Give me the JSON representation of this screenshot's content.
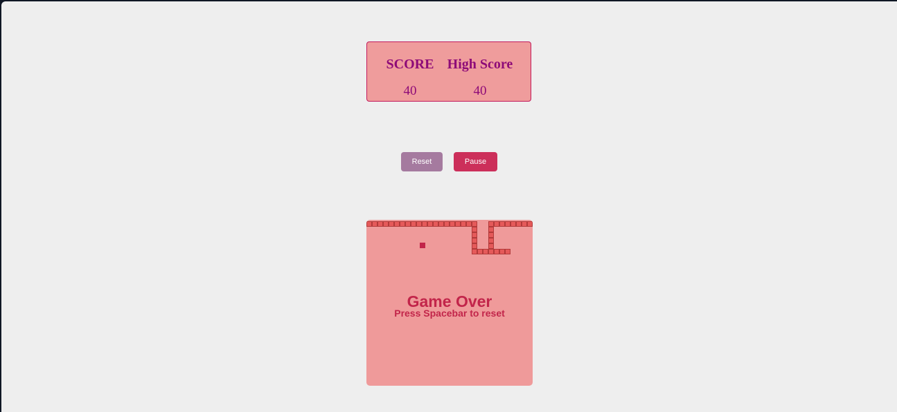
{
  "scoreboard": {
    "score_label": "SCORE",
    "score_value": "40",
    "high_score_label": "High Score",
    "high_score_value": "40"
  },
  "controls": {
    "reset_label": "Reset",
    "pause_label": "Pause"
  },
  "game": {
    "status_title": "Game Over",
    "status_hint": "Press Spacebar to reset",
    "grid_size": 30,
    "snake_cells": [
      [
        0,
        0
      ],
      [
        1,
        0
      ],
      [
        2,
        0
      ],
      [
        3,
        0
      ],
      [
        4,
        0
      ],
      [
        5,
        0
      ],
      [
        6,
        0
      ],
      [
        7,
        0
      ],
      [
        8,
        0
      ],
      [
        9,
        0
      ],
      [
        10,
        0
      ],
      [
        11,
        0
      ],
      [
        12,
        0
      ],
      [
        13,
        0
      ],
      [
        14,
        0
      ],
      [
        15,
        0
      ],
      [
        16,
        0
      ],
      [
        17,
        0
      ],
      [
        18,
        0
      ],
      [
        22,
        0
      ],
      [
        23,
        0
      ],
      [
        24,
        0
      ],
      [
        25,
        0
      ],
      [
        26,
        0
      ],
      [
        27,
        0
      ],
      [
        28,
        0
      ],
      [
        29,
        0
      ],
      [
        19,
        0
      ],
      [
        19,
        1
      ],
      [
        19,
        2
      ],
      [
        19,
        3
      ],
      [
        19,
        4
      ],
      [
        19,
        5
      ],
      [
        22,
        1
      ],
      [
        22,
        2
      ],
      [
        22,
        3
      ],
      [
        22,
        4
      ],
      [
        22,
        5
      ],
      [
        20,
        5
      ],
      [
        21,
        5
      ],
      [
        23,
        5
      ],
      [
        24,
        5
      ],
      [
        25,
        5
      ]
    ],
    "food_cell": [
      10,
      4
    ],
    "colors": {
      "board": "#ef9a9a",
      "snake": "#e55a5a",
      "food": "#c2254a",
      "text": "#c2254a"
    }
  }
}
